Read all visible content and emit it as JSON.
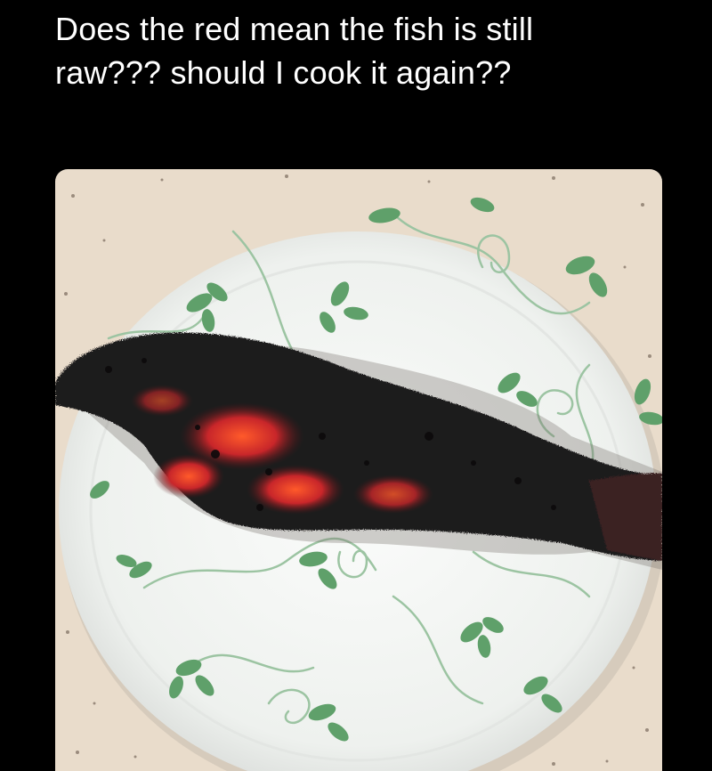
{
  "post": {
    "caption_line1": "Does the red mean the fish is still",
    "caption_line2": "raw??? should I cook it again??"
  },
  "photo": {
    "subject": "burnt-fish-on-plate",
    "colors": {
      "background": "#000000",
      "counter": "#e9dccb",
      "plate": "#f4f6f3",
      "leaf": "#5fa06a",
      "vine": "#9cc4a2",
      "char": "#1e1a1c",
      "raw": "#c8262a"
    }
  }
}
